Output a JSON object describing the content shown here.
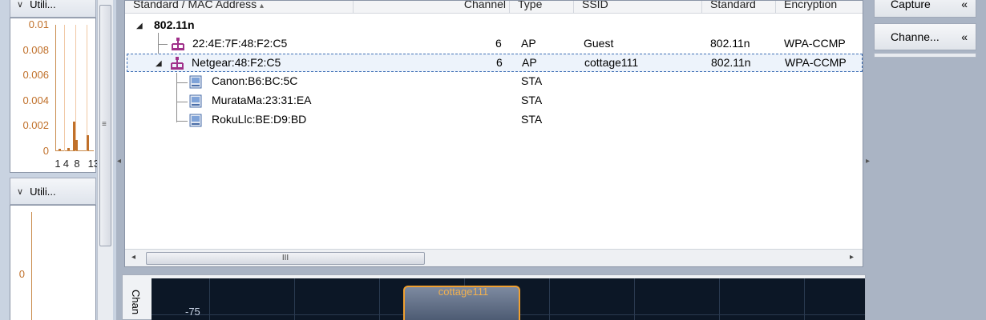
{
  "left_panel": {
    "top_panel": {
      "header_label": "Utili...",
      "y_ticks": [
        "0.01",
        "0.008",
        "0.006",
        "0.004",
        "0.002",
        "0"
      ],
      "x_ticks": [
        "1",
        "4",
        "8",
        "13"
      ],
      "bars": [
        {
          "x": 1,
          "value": 0.0001
        },
        {
          "x": 4,
          "value": 0.0002
        },
        {
          "x": 6,
          "value": 0.0023
        },
        {
          "x": 7,
          "value": 0.0008
        },
        {
          "x": 11,
          "value": 0.0012
        }
      ]
    },
    "bottom_panel": {
      "header_label": "Utili...",
      "y_ticks": [
        "0"
      ]
    }
  },
  "table": {
    "columns": [
      "Standard / MAC Address",
      "Channel",
      "Type",
      "SSID",
      "Standard",
      "Encryption"
    ],
    "group_label": "802.11n",
    "rows": [
      {
        "name": "22:4E:7F:48:F2:C5",
        "channel": "6",
        "type": "AP",
        "ssid": "Guest",
        "standard": "802.11n",
        "encryption": "WPA-CCMP"
      },
      {
        "name": "Netgear:48:F2:C5",
        "channel": "6",
        "type": "AP",
        "ssid": "cottage111",
        "standard": "802.11n",
        "encryption": "WPA-CCMP"
      },
      {
        "name": "Canon:B6:BC:5C",
        "channel": "",
        "type": "STA",
        "ssid": "",
        "standard": "",
        "encryption": ""
      },
      {
        "name": "MurataMa:23:31:EA",
        "channel": "",
        "type": "STA",
        "ssid": "",
        "standard": "",
        "encryption": ""
      },
      {
        "name": "RokuLlc:BE:D9:BD",
        "channel": "",
        "type": "STA",
        "ssid": "",
        "standard": "",
        "encryption": ""
      }
    ],
    "hscroll_grip": "III"
  },
  "spectrum": {
    "tab_label": "Chan",
    "network_label": "cottage111",
    "y_label": "-75"
  },
  "right_panel": {
    "capture_label": "Capture",
    "channels_label": "Channe...",
    "collapse_glyph": "«"
  },
  "colors": {
    "ap_icon": "#a0308a",
    "selection_border": "#3f6fb5",
    "axis": "#c0702a",
    "spectrum_bg": "#0c1726",
    "network_border": "#f0a030"
  }
}
